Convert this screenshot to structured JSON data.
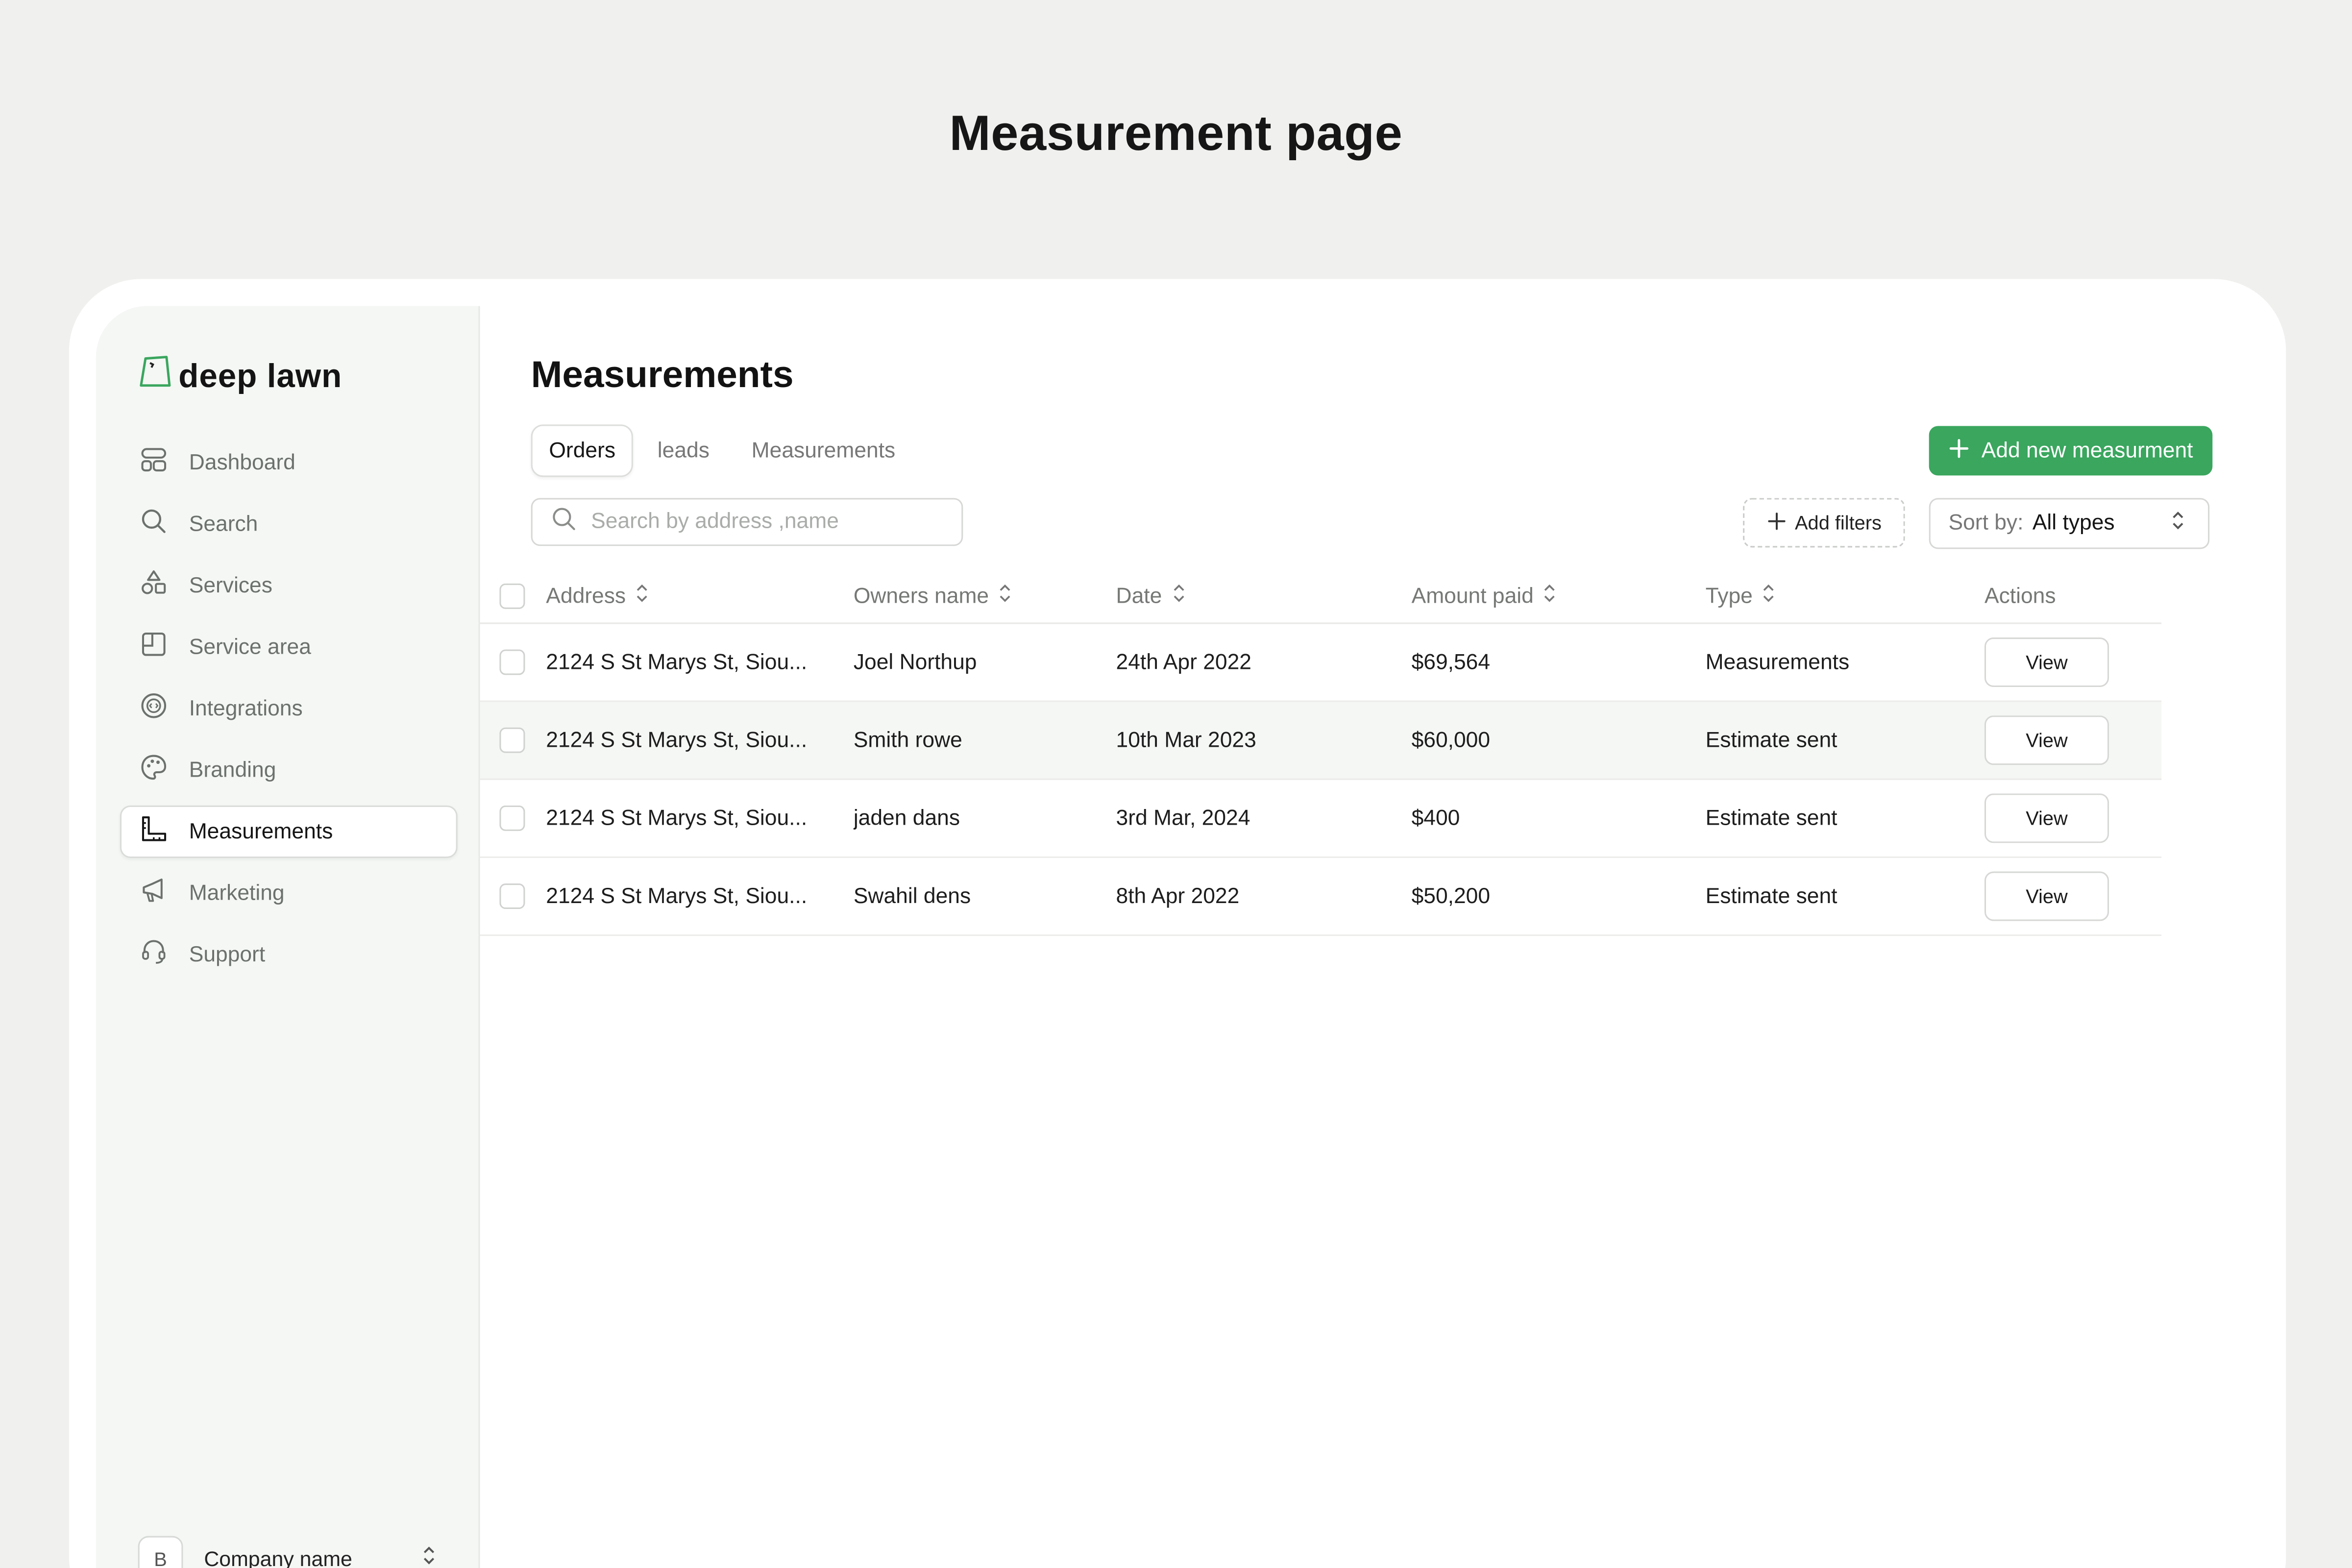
{
  "page_title": "Measurement page",
  "brand": {
    "name": "deep lawn"
  },
  "sidebar": {
    "items": [
      {
        "label": "Dashboard",
        "icon": "dashboard-icon",
        "active": false
      },
      {
        "label": "Search",
        "icon": "search-icon",
        "active": false
      },
      {
        "label": "Services",
        "icon": "services-icon",
        "active": false
      },
      {
        "label": "Service area",
        "icon": "service-area-icon",
        "active": false
      },
      {
        "label": "Integrations",
        "icon": "integrations-icon",
        "active": false
      },
      {
        "label": "Branding",
        "icon": "palette-icon",
        "active": false
      },
      {
        "label": "Measurements",
        "icon": "ruler-icon",
        "active": true
      },
      {
        "label": "Marketing",
        "icon": "megaphone-icon",
        "active": false
      },
      {
        "label": "Support",
        "icon": "headset-icon",
        "active": false
      }
    ],
    "company": {
      "avatar_letter": "B",
      "name": "Company name"
    }
  },
  "main": {
    "title": "Measurements",
    "tabs": [
      {
        "label": "Orders",
        "active": true
      },
      {
        "label": "leads",
        "active": false
      },
      {
        "label": "Measurements",
        "active": false
      }
    ],
    "add_button_label": "Add new measurment",
    "search_placeholder": "Search by address ,name",
    "filters_label": "Add filters",
    "sort": {
      "label": "Sort by:",
      "value": "All types"
    }
  },
  "table": {
    "headers": {
      "address": "Address",
      "owner": "Owners name",
      "date": "Date",
      "amount": "Amount paid",
      "type": "Type",
      "actions": "Actions"
    },
    "view_label": "View",
    "rows": [
      {
        "address": "2124 S St Marys St, Siou...",
        "owner": "Joel Northup",
        "date": "24th Apr 2022",
        "amount": "$69,564",
        "type": "Measurements"
      },
      {
        "address": "2124 S St Marys St, Siou...",
        "owner": "Smith rowe",
        "date": "10th Mar 2023",
        "amount": "$60,000",
        "type": "Estimate sent"
      },
      {
        "address": "2124 S St Marys St, Siou...",
        "owner": "jaden dans",
        "date": "3rd Mar, 2024",
        "amount": "$400",
        "type": "Estimate sent"
      },
      {
        "address": "2124 S St Marys St, Siou...",
        "owner": "Swahil dens",
        "date": "8th Apr 2022",
        "amount": "$50,200",
        "type": "Estimate sent"
      }
    ]
  },
  "colors": {
    "accent": "#3aa65e",
    "page_bg": "#f0f0ee",
    "sidebar_bg": "#f4f7f4"
  }
}
